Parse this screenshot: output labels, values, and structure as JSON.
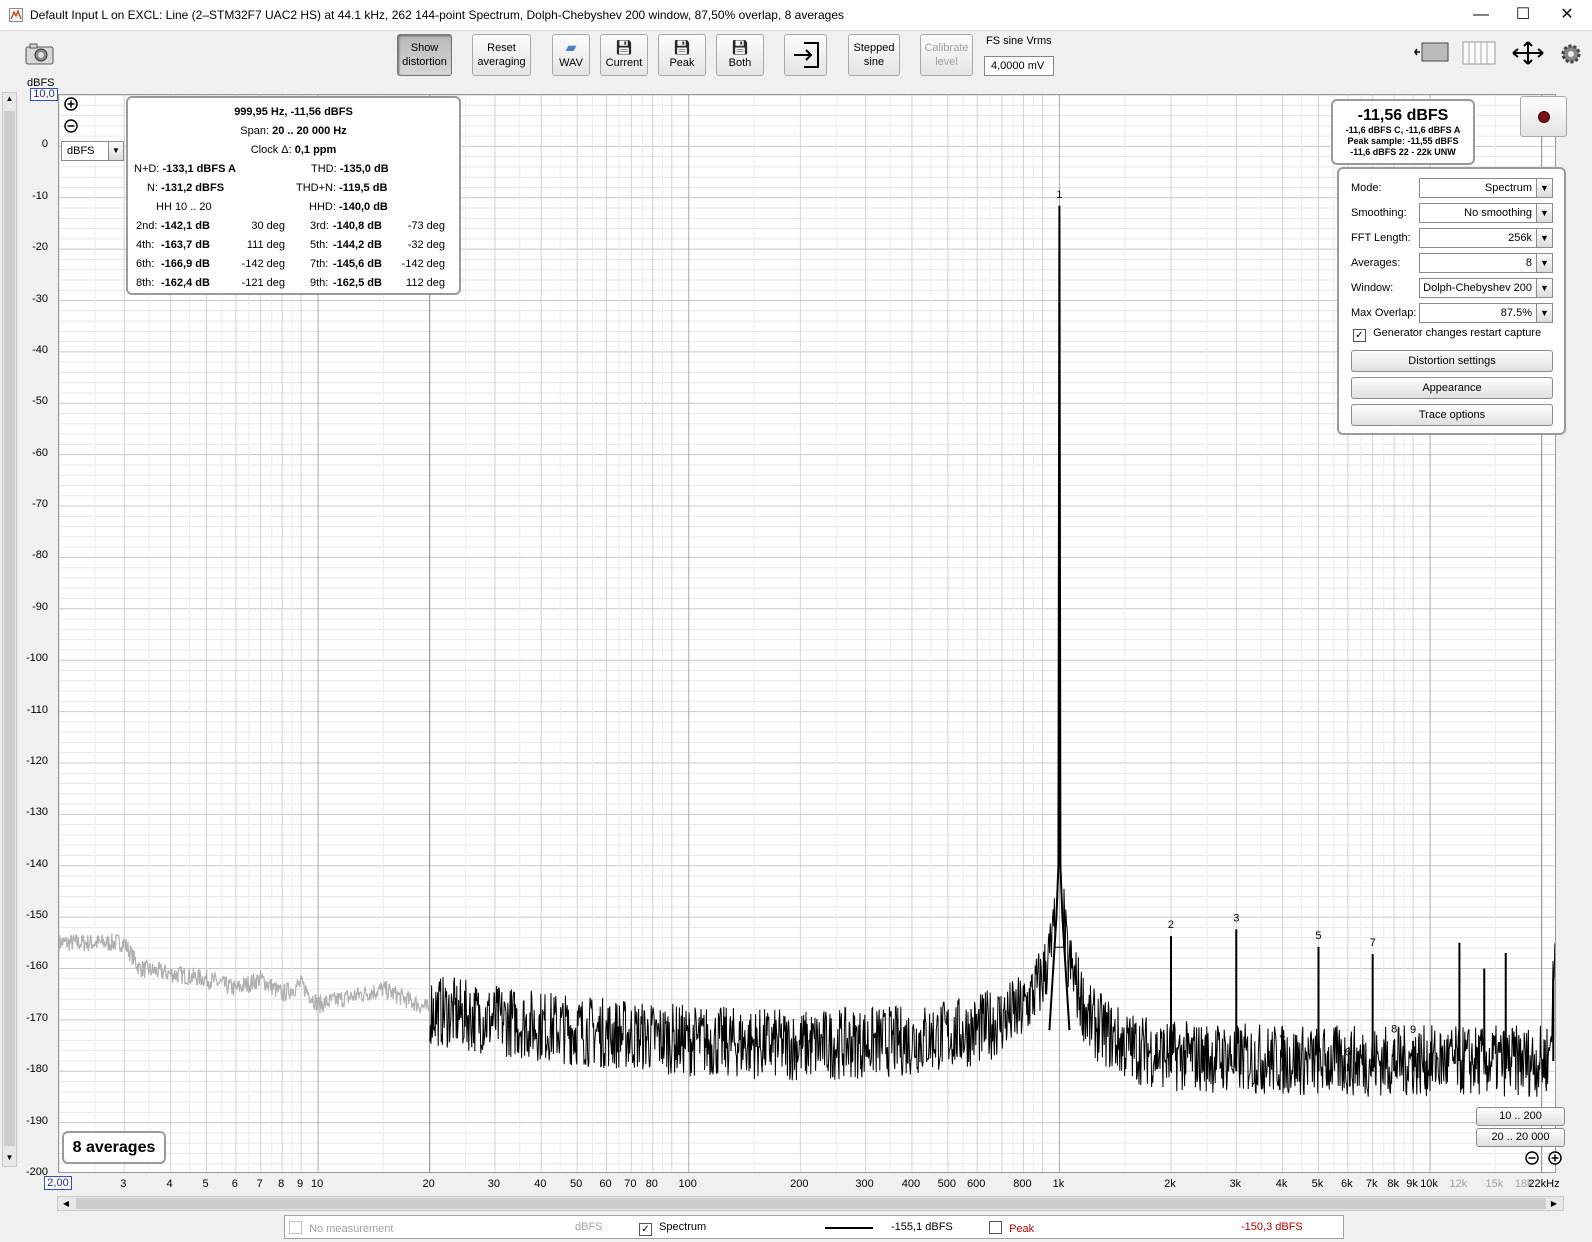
{
  "window": {
    "title": "Default Input L on EXCL: Line (2–STM32F7 UAC2 HS) at 44.1 kHz, 262 144-point Spectrum, Dolph-Chebyshev 200 window, 87,50% overlap, 8 averages",
    "min": "—",
    "max": "☐",
    "close": "✕"
  },
  "toolbar": {
    "show_distortion": [
      "Show",
      "distortion"
    ],
    "reset_averaging": [
      "Reset",
      "averaging"
    ],
    "wav": "WAV",
    "current": "Current",
    "peak": "Peak",
    "both": "Both",
    "stepped_sine": [
      "Stepped",
      "sine"
    ],
    "calibrate_level": [
      "Calibrate",
      "level"
    ],
    "fs_label": "FS sine Vrms",
    "fs_value": "4,0000 mV"
  },
  "axes": {
    "y_unit": "dBFS",
    "y_top_box": "10,0",
    "x_left_box": "2,00",
    "y_unit_select": "dBFS"
  },
  "distortion": {
    "freq_level": "999,95 Hz, -11,56 dBFS",
    "span_label": "Span:",
    "span_value": "20 .. 20 000 Hz",
    "clock_label": "Clock Δ:",
    "clock_value": "0,1 ppm",
    "nd_label": "N+D:",
    "nd_value": "-133,1 dBFS A",
    "thd_label": "THD:",
    "thd_value": "-135,0 dB",
    "n_label": "N:",
    "n_value": "-131,2 dBFS",
    "thdn_label": "THD+N:",
    "thdn_value": "-119,5 dB",
    "hh_label": "HH 10 .. 20",
    "hhd_label": "HHD:",
    "hhd_value": "-140,0 dB",
    "harmonics": [
      {
        "l": "2nd:",
        "v": "-142,1 dB",
        "p": "30 deg",
        "l2": "3rd:",
        "v2": "-140,8 dB",
        "p2": "-73 deg"
      },
      {
        "l": "4th:",
        "v": "-163,7 dB",
        "p": "111 deg",
        "l2": "5th:",
        "v2": "-144,2 dB",
        "p2": "-32 deg"
      },
      {
        "l": "6th:",
        "v": "-166,9 dB",
        "p": "-142 deg",
        "l2": "7th:",
        "v2": "-145,6 dB",
        "p2": "-142 deg"
      },
      {
        "l": "8th:",
        "v": "-162,4 dB",
        "p": "-121 deg",
        "l2": "9th:",
        "v2": "-162,5 dB",
        "p2": "112 deg"
      }
    ]
  },
  "level": {
    "main": "-11,56 dBFS",
    "line1": "-11,6 dBFS C, -11,6 dBFS A",
    "line2": "Peak sample: -11,55 dBFS",
    "line3": "-11,6 dBFS 22 - 22k UNW"
  },
  "settings": {
    "mode_label": "Mode:",
    "mode_value": "Spectrum",
    "smoothing_label": "Smoothing:",
    "smoothing_value": "No  smoothing",
    "fft_label": "FFT Length:",
    "fft_value": "256k",
    "averages_label": "Averages:",
    "averages_value": "8",
    "window_label": "Window:",
    "window_value": "Dolph-Chebyshev 200",
    "overlap_label": "Max Overlap:",
    "overlap_value": "87.5%",
    "generator_label": "Generator changes restart capture",
    "distortion_settings": "Distortion settings",
    "appearance": "Appearance",
    "trace_options": "Trace options"
  },
  "averages_badge": "8 averages",
  "range_buttons": [
    "10 .. 200",
    "20 .. 20 000"
  ],
  "legend": {
    "no_measurement": "No measurement",
    "no_measurement_unit": "dBFS",
    "spectrum": "Spectrum",
    "spectrum_value": "-155,1 dBFS",
    "peak": "Peak",
    "peak_value": "-150,3 dBFS"
  },
  "colors": {
    "trace": "#000000",
    "trace_lowfreq": "#b0b0b0",
    "peak_value": "#c00000"
  },
  "chart_data": {
    "type": "line",
    "xscale": "log",
    "xlim": [
      2,
      22000
    ],
    "ylim": [
      -200,
      10
    ],
    "yticks": [
      0,
      -10,
      -20,
      -30,
      -40,
      -50,
      -60,
      -70,
      -80,
      -90,
      -100,
      -110,
      -120,
      -130,
      -140,
      -150,
      -160,
      -170,
      -180,
      -190,
      -200
    ],
    "xticks": [
      {
        "v": 3,
        "t": "3"
      },
      {
        "v": 4,
        "t": "4"
      },
      {
        "v": 5,
        "t": "5"
      },
      {
        "v": 6,
        "t": "6"
      },
      {
        "v": 7,
        "t": "7"
      },
      {
        "v": 8,
        "t": "8"
      },
      {
        "v": 9,
        "t": "9"
      },
      {
        "v": 10,
        "t": "10"
      },
      {
        "v": 20,
        "t": "20"
      },
      {
        "v": 30,
        "t": "30"
      },
      {
        "v": 40,
        "t": "40"
      },
      {
        "v": 50,
        "t": "50"
      },
      {
        "v": 60,
        "t": "60"
      },
      {
        "v": 70,
        "t": "70"
      },
      {
        "v": 80,
        "t": "80"
      },
      {
        "v": 100,
        "t": "100"
      },
      {
        "v": 200,
        "t": "200"
      },
      {
        "v": 300,
        "t": "300"
      },
      {
        "v": 400,
        "t": "400"
      },
      {
        "v": 500,
        "t": "500"
      },
      {
        "v": 600,
        "t": "600"
      },
      {
        "v": 800,
        "t": "800"
      },
      {
        "v": 1000,
        "t": "1k"
      },
      {
        "v": 2000,
        "t": "2k"
      },
      {
        "v": 3000,
        "t": "3k"
      },
      {
        "v": 4000,
        "t": "4k"
      },
      {
        "v": 5000,
        "t": "5k"
      },
      {
        "v": 6000,
        "t": "6k"
      },
      {
        "v": 7000,
        "t": "7k"
      },
      {
        "v": 8000,
        "t": "8k"
      },
      {
        "v": 9000,
        "t": "9k"
      },
      {
        "v": 10000,
        "t": "10k"
      },
      {
        "v": 12000,
        "t": "12k",
        "grey": true
      },
      {
        "v": 15000,
        "t": "15k",
        "grey": true
      },
      {
        "v": 18000,
        "t": "18k",
        "grey": true
      },
      {
        "v": 22000,
        "t": "22kHz"
      }
    ],
    "analysis_band": [
      20,
      20000
    ],
    "noise_floor": [
      {
        "x": 2,
        "y": -155
      },
      {
        "x": 3,
        "y": -155
      },
      {
        "x": 3.3,
        "y": -160
      },
      {
        "x": 4,
        "y": -161
      },
      {
        "x": 5,
        "y": -162
      },
      {
        "x": 6,
        "y": -164
      },
      {
        "x": 7,
        "y": -162
      },
      {
        "x": 8,
        "y": -165
      },
      {
        "x": 9,
        "y": -163
      },
      {
        "x": 10,
        "y": -167
      },
      {
        "x": 15,
        "y": -164
      },
      {
        "x": 20,
        "y": -168
      },
      {
        "x": 30,
        "y": -170
      },
      {
        "x": 50,
        "y": -172
      },
      {
        "x": 100,
        "y": -174
      },
      {
        "x": 200,
        "y": -175
      },
      {
        "x": 400,
        "y": -174
      },
      {
        "x": 600,
        "y": -172
      },
      {
        "x": 800,
        "y": -168
      },
      {
        "x": 900,
        "y": -162
      },
      {
        "x": 960,
        "y": -155
      },
      {
        "x": 990,
        "y": -145
      },
      {
        "x": 1000,
        "y": -11.56
      },
      {
        "x": 1010,
        "y": -145
      },
      {
        "x": 1050,
        "y": -158
      },
      {
        "x": 1200,
        "y": -170
      },
      {
        "x": 1500,
        "y": -175
      },
      {
        "x": 2000,
        "y": -177
      },
      {
        "x": 5000,
        "y": -178
      },
      {
        "x": 10000,
        "y": -178
      },
      {
        "x": 20000,
        "y": -178
      },
      {
        "x": 21000,
        "y": -177
      },
      {
        "x": 22000,
        "y": -150
      }
    ],
    "harmonic_markers": [
      {
        "label": "1",
        "x": 1000,
        "y": -11.56
      },
      {
        "label": "2",
        "x": 2000,
        "y": -153.7
      },
      {
        "label": "3",
        "x": 3000,
        "y": -152.4
      },
      {
        "label": "4",
        "x": 4000,
        "y": -175.3
      },
      {
        "label": "5",
        "x": 5000,
        "y": -155.8
      },
      {
        "label": "6",
        "x": 6000,
        "y": -178.5
      },
      {
        "label": "7",
        "x": 7000,
        "y": -157.2
      },
      {
        "label": "8",
        "x": 8000,
        "y": -174
      },
      {
        "label": "9",
        "x": 9000,
        "y": -174.1
      }
    ],
    "extra_spurs": [
      {
        "x": 12000,
        "y": -155
      },
      {
        "x": 14000,
        "y": -160
      },
      {
        "x": 16000,
        "y": -157
      },
      {
        "x": 21500,
        "y": -162
      }
    ]
  }
}
